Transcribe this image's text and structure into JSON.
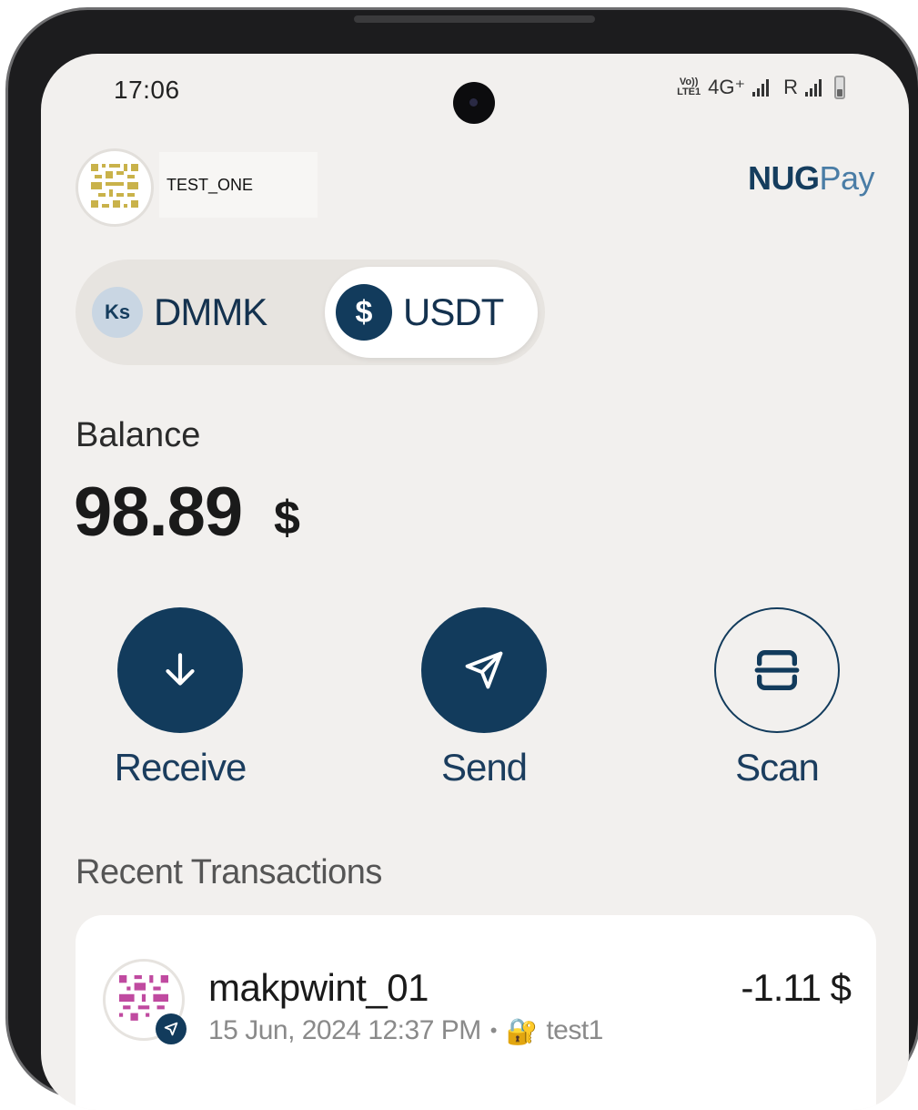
{
  "status_bar": {
    "time": "17:06",
    "volte_top": "Vo))",
    "volte_bottom": "LTE1",
    "network": "4G⁺",
    "roaming": "R"
  },
  "header": {
    "username": "TEST_ONE",
    "brand_bold": "NUG",
    "brand_light": "Pay",
    "brand_colors": {
      "primary": "#153d5e",
      "secondary": "#4a7da6"
    }
  },
  "currency_toggle": {
    "options": [
      {
        "badge": "Ks",
        "label": "DMMK",
        "selected": false
      },
      {
        "badge": "$",
        "label": "USDT",
        "selected": true
      }
    ]
  },
  "balance": {
    "label": "Balance",
    "amount": "98.89",
    "currency": "$"
  },
  "actions": [
    {
      "label": "Receive",
      "icon": "arrow-down-icon"
    },
    {
      "label": "Send",
      "icon": "paper-plane-icon"
    },
    {
      "label": "Scan",
      "icon": "scan-icon"
    }
  ],
  "recent": {
    "title": "Recent Transactions",
    "transactions": [
      {
        "name": "makpwint_01",
        "date": "15 Jun, 2024 12:37 PM",
        "separator": "•",
        "note_icon": "🔐",
        "note": "test1",
        "amount": "-1.11 $",
        "type": "send"
      }
    ]
  },
  "colors": {
    "accent": "#123b5c",
    "background": "#f2f0ee"
  }
}
